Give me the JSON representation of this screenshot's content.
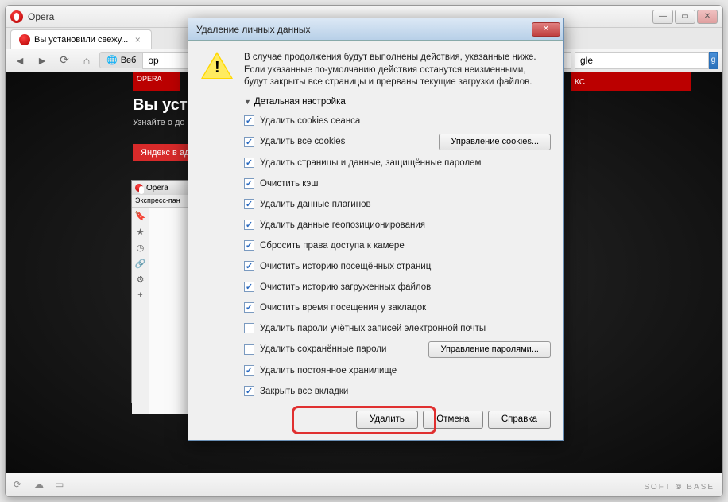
{
  "browser": {
    "app_title": "Opera",
    "tab": {
      "label": "Вы установили свежу...",
      "close_glyph": "×"
    },
    "toolbar": {
      "back_glyph": "◄",
      "forward_glyph": "►",
      "reload_glyph": "⟳",
      "home_glyph": "⌂",
      "addr_label": "Веб",
      "addr_value": "op",
      "search_placeholder": "gle"
    },
    "hero": {
      "title": "Вы уста",
      "subtitle": "Узнайте о до"
    },
    "yandex_btn": "Яндекс в адр",
    "opera_logo_text": "OPERA",
    "right_box": "КС",
    "mini": {
      "title": "Opera",
      "subtab": "Экспресс-пан"
    },
    "status": {
      "soft_base": "SOFT ⦾ BASE"
    },
    "win": {
      "min": "—",
      "max": "▭",
      "close": "✕"
    }
  },
  "dialog": {
    "title": "Удаление личных данных",
    "close_glyph": "✕",
    "message": "В случае продолжения будут выполнены действия, указанные ниже. Если указанные по-умолчанию действия останутся неизменными, будут закрыты все страницы и прерваны текущие загрузки файлов.",
    "details_label": "Детальная настройка",
    "items": [
      {
        "label": "Удалить cookies сеанса",
        "checked": true
      },
      {
        "label": "Удалить все cookies",
        "checked": true,
        "button": "Управление cookies..."
      },
      {
        "label": "Удалить страницы и данные, защищённые паролем",
        "checked": true
      },
      {
        "label": "Очистить кэш",
        "checked": true
      },
      {
        "label": "Удалить данные плагинов",
        "checked": true
      },
      {
        "label": "Удалить данные геопозиционирования",
        "checked": true
      },
      {
        "label": "Сбросить права доступа к камере",
        "checked": true
      },
      {
        "label": "Очистить историю посещённых страниц",
        "checked": true
      },
      {
        "label": "Очистить историю загруженных файлов",
        "checked": true
      },
      {
        "label": "Очистить время посещения у закладок",
        "checked": true
      },
      {
        "label": "Удалить пароли учётных записей электронной почты",
        "checked": false
      },
      {
        "label": "Удалить сохранённые пароли",
        "checked": false,
        "button": "Управление паролями..."
      },
      {
        "label": "Удалить постоянное хранилище",
        "checked": true
      },
      {
        "label": "Закрыть все вкладки",
        "checked": true
      }
    ],
    "buttons": {
      "ok": "Удалить",
      "cancel": "Отмена",
      "help": "Справка"
    }
  }
}
